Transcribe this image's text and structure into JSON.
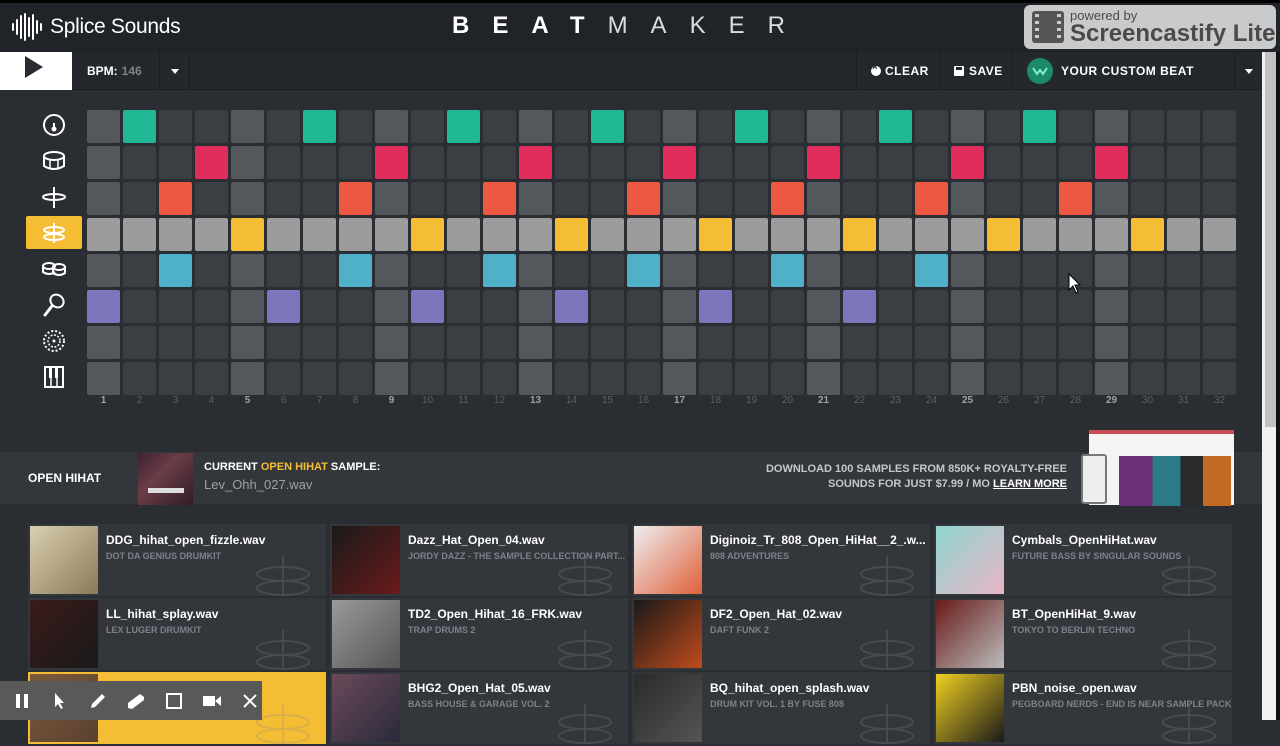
{
  "header": {
    "brand": "Splice Sounds",
    "title_bold": "BEAT",
    "title_light": "MAKER",
    "overlay": {
      "small": "powered by",
      "big": "Screencastify Lite"
    }
  },
  "toolbar": {
    "play_icon": "play-icon",
    "bpm_label": "BPM:",
    "bpm_value": "146",
    "clear_label": "CLEAR",
    "save_label": "SAVE",
    "beat_name": "YOUR CUSTOM BEAT"
  },
  "sequencer": {
    "steps": 32,
    "beat_columns": [
      1,
      5,
      9,
      13,
      17,
      21,
      25,
      29
    ],
    "selected_row": 3,
    "rows": [
      {
        "instrument": "kick",
        "icon": "kick-drum-icon",
        "color": "#1fb794",
        "active": [
          2,
          7,
          11,
          15,
          19,
          23,
          27
        ]
      },
      {
        "instrument": "snare",
        "icon": "snare-drum-icon",
        "color": "#e02d5e",
        "active": [
          4,
          9,
          13,
          17,
          21,
          25,
          29
        ]
      },
      {
        "instrument": "closed hihat",
        "icon": "cymbal-icon",
        "color": "#ee5843",
        "active": [
          3,
          8,
          12,
          16,
          20,
          24,
          28
        ]
      },
      {
        "instrument": "open hihat",
        "icon": "open-hihat-icon",
        "color": "#f5bd34",
        "active": [
          5,
          10,
          14,
          18,
          22,
          26,
          30
        ]
      },
      {
        "instrument": "toms",
        "icon": "tom-drums-icon",
        "color": "#4fb0ca",
        "active": [
          3,
          8,
          12,
          16,
          20,
          24
        ]
      },
      {
        "instrument": "maraca",
        "icon": "maraca-icon",
        "color": "#7e76bd",
        "active": [
          1,
          6,
          10,
          14,
          18,
          22
        ]
      },
      {
        "instrument": "tambourine",
        "icon": "tambourine-icon",
        "color": "#888888",
        "active": []
      },
      {
        "instrument": "keys",
        "icon": "piano-keys-icon",
        "color": "#888888",
        "active": []
      }
    ]
  },
  "sample_bar": {
    "instrument_label": "OPEN HIHAT",
    "current_prefix": "CURRENT ",
    "current_instrument": "OPEN HIHAT",
    "current_suffix": " SAMPLE:",
    "current_file": "Lev_Ohh_027.wav",
    "promo_line1": "DOWNLOAD 100 SAMPLES FROM 850K+ ROYALTY-FREE",
    "promo_line2": "SOUNDS FOR JUST $7.99 / MO ",
    "promo_link": "LEARN MORE"
  },
  "samples": [
    [
      {
        "name": "DDG_hihat_open_fizzle.wav",
        "pack": "DOT DA GENIUS DRUMKIT",
        "art": [
          "#d9cfb0",
          "#8a7b5a"
        ]
      },
      {
        "name": "Dazz_Hat_Open_04.wav",
        "pack": "JORDY DAZZ - THE SAMPLE COLLECTION PART...",
        "art": [
          "#1a1a1a",
          "#6b1a1a"
        ]
      },
      {
        "name": "Diginoiz_Tr_808_Open_HiHat__2_.w...",
        "pack": "808 ADVENTURES",
        "art": [
          "#eeeeee",
          "#e0603a"
        ]
      },
      {
        "name": "Cymbals_OpenHiHat.wav",
        "pack": "FUTURE BASS BY SINGULAR SOUNDS",
        "art": [
          "#8fd6d0",
          "#e8b5c5"
        ]
      }
    ],
    [
      {
        "name": "LL_hihat_splay.wav",
        "pack": "LEX LUGER DRUMKIT",
        "art": [
          "#3a1a1a",
          "#1a1a1a"
        ]
      },
      {
        "name": "TD2_Open_Hihat_16_FRK.wav",
        "pack": "TRAP DRUMS 2",
        "art": [
          "#9a9a9a",
          "#555555"
        ]
      },
      {
        "name": "DF2_Open_Hat_02.wav",
        "pack": "DAFT FUNK 2",
        "art": [
          "#1a1a1a",
          "#c04a1a"
        ]
      },
      {
        "name": "BT_OpenHiHat_9.wav",
        "pack": "TOKYO TO BERLIN TECHNO",
        "art": [
          "#6a1a1a",
          "#bbbbbb"
        ]
      }
    ],
    [
      {
        "name": "",
        "pack": "",
        "art": [
          "#7a5a3a",
          "#5a4030"
        ],
        "highlight": true
      },
      {
        "name": "BHG2_Open_Hat_05.wav",
        "pack": "BASS HOUSE & GARAGE VOL. 2",
        "art": [
          "#6a4a5a",
          "#2a2a3a"
        ]
      },
      {
        "name": "BQ_hihat_open_splash.wav",
        "pack": "DRUM KIT VOL. 1 BY FUSE 808",
        "art": [
          "#2a2a2a",
          "#555555"
        ]
      },
      {
        "name": "PBN_noise_open.wav",
        "pack": "PEGBOARD NERDS - END IS NEAR SAMPLE PACK",
        "art": [
          "#f0d020",
          "#1a1a1a"
        ]
      }
    ]
  ],
  "recorder_toolbar": [
    "pause-icon",
    "pointer-icon",
    "pen-icon",
    "eraser-icon",
    "rectangle-icon",
    "camera-icon",
    "close-icon"
  ]
}
